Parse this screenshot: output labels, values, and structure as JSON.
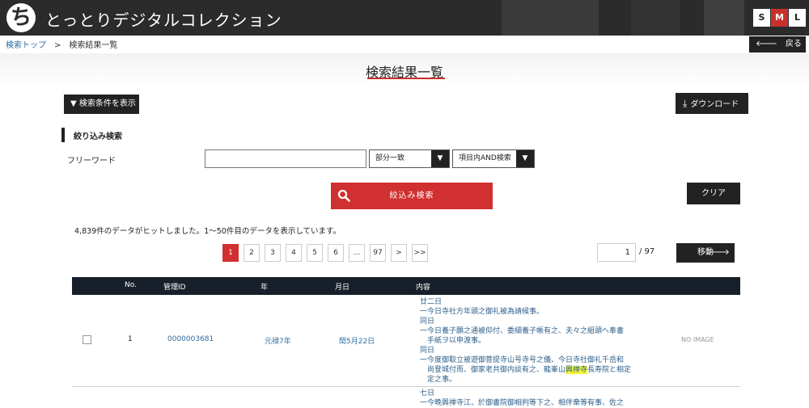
{
  "header": {
    "site_title": "とっとりデジタルコレクション",
    "logo_glyph": "ち",
    "size_buttons": [
      "S",
      "M",
      "L"
    ],
    "active_size": "M"
  },
  "breadcrumb": {
    "top": "検索トップ",
    "separator": ">",
    "current": "検索結果一覧"
  },
  "back_button": {
    "arrow": "🡐",
    "label": "戻る"
  },
  "page_title": "検索結果一覧",
  "show_conditions": "▼ 検索条件を表示",
  "download": {
    "icon": "⤓",
    "label": "ダウンロード"
  },
  "filter": {
    "title": "絞り込み検索",
    "freeword_label": "フリーワード",
    "freeword_value": "",
    "match_select": "部分一致",
    "mode_select": "項目内AND検索",
    "caret": "▼",
    "search_button": "絞込み検索",
    "clear_button": "クリア"
  },
  "result_info": "4,839件のデータがヒットしました。1～50件目のデータを表示しています。",
  "pager": {
    "pages": [
      "1",
      "2",
      "3",
      "4",
      "5",
      "6",
      "…",
      "97",
      ">",
      ">>"
    ],
    "active": "1",
    "page_input": "1",
    "total": "/ 97",
    "move_button": "移動",
    "move_arrow": "🡒"
  },
  "table": {
    "headers": [
      "No.",
      "管理ID",
      "年",
      "月日",
      "内容"
    ],
    "rows": [
      {
        "no": "1",
        "id": "0000003681",
        "year": "元禄7年",
        "date": "閏5月22日",
        "content_lines": [
          "廿二日",
          "一今日寺社方年頭之御礼被為請候事。",
          "同日",
          "一今日養子願之通被仰付、委細養子帳有之、夫々之組頭へ奉書",
          "手紙ヲ以申渡事。",
          "同日",
          "一今度御取立被遊御菩提寺山号寺号之儀、今日寺社御礼千岳和",
          "尚登城付而、御家老共御内談有之、龍峯山興禅寺長寿院と相定",
          "定之事。"
        ],
        "highlight": "興禅寺",
        "image": "NO IMAGE"
      }
    ],
    "next_row_lines": [
      "七日",
      "一今晩興禅寺江、於御書院御相判等下之、相伴衆等有事、佐之"
    ]
  }
}
